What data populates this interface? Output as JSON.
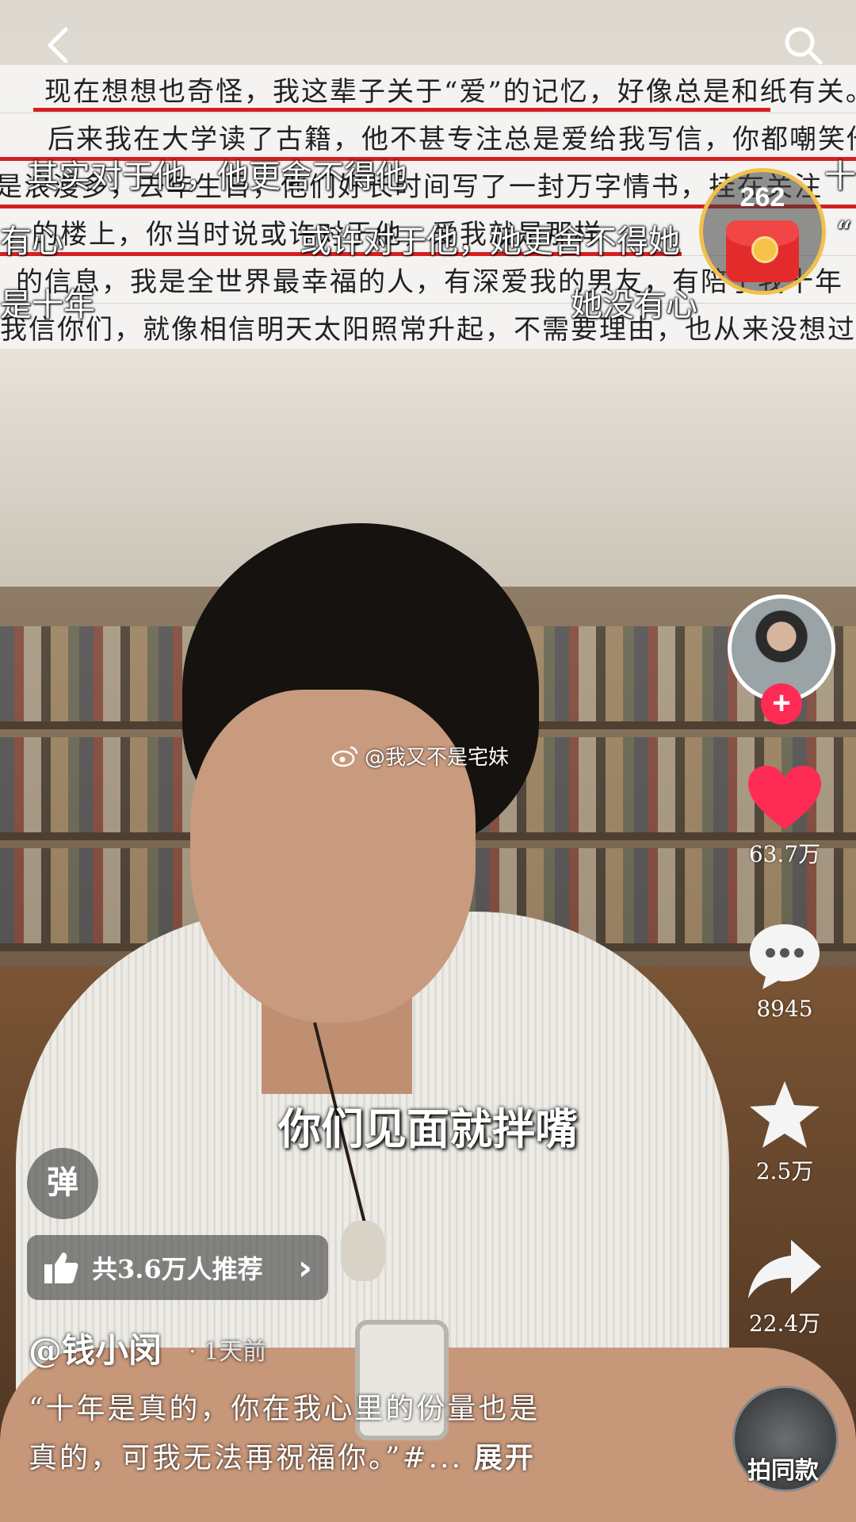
{
  "handwritten_note": {
    "lines": [
      "现在想想也奇怪，我这辈子关于“爱”的记忆，好像总是和纸有关。",
      "后来我在大学读了古籍，他不甚专注总是爱给我写信，你都嘲笑他",
      "是浪漫多，去年生日，他们好长时间写了一封万字情书，挂在关注",
      "的楼上，你当时说或许对于他，爱我就是那样",
      "的信息，我是全世界最幸福的人，有深爱我的男友，有陪了我十年",
      "我信你们，就像相信明天太阳照常升起，不需要理由，也从来没想过要验证。"
    ]
  },
  "danmaku": [
    "其实对于他，他更舍不得他",
    "有心",
    "或许对于他，她更舍不得她",
    "是十年",
    "她没有心",
    "十",
    "“"
  ],
  "red_packet": {
    "count": "262"
  },
  "watermark": {
    "handle": "@我又不是宅妹"
  },
  "subtitle": "你们见面就拌嘴",
  "actions": {
    "likes": "63.7万",
    "comments": "8945",
    "favorites": "2.5万",
    "shares": "22.4万",
    "same_style": "拍同款"
  },
  "follow_label": "+",
  "danmaku_toggle": "弹",
  "recommend": {
    "label": "共3.6万人推荐",
    "arrow": "›"
  },
  "post": {
    "author": "@钱小闵",
    "time": "· 1天前",
    "desc_line1": "“十年是真的，你在我心里的份量也是",
    "desc_line2": "真的，可我无法再祝福你。”#...",
    "expand": "展开"
  },
  "colors": {
    "like": "#fe2c55",
    "follow": "#fe2c55",
    "note_underline": "#d42020",
    "red_packet_ring": "#f2c14a"
  }
}
